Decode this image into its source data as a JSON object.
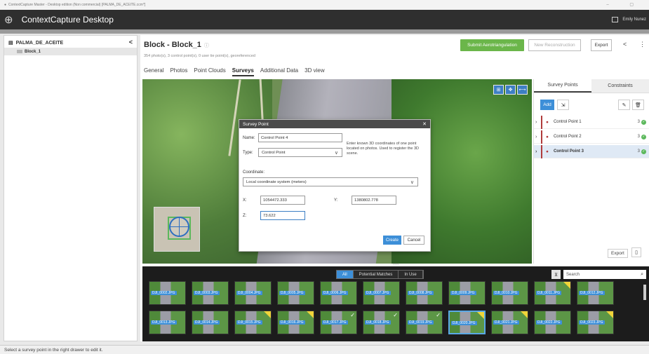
{
  "window": {
    "title": "ContextCapture Master - Desktop edition (Non commercial) [PALMA_DE_ACEITE.ccm*]",
    "controls": "–   ▢"
  },
  "app": {
    "title": "ContextCapture Desktop",
    "user": "Emily Nunez"
  },
  "project": {
    "name": "PALMA_DE_ACEITE",
    "collapse": "<",
    "block": "Block_1"
  },
  "block": {
    "title": "Block - Block_1",
    "info_icon": "ⓘ",
    "subtitle": "354 photo(s), 3 control point(s), 0 user tie point(s), georeferenced",
    "submit_label": "Submit Aerotriangulation",
    "new_recon_label": "New Reconstruction",
    "export_label": "Export"
  },
  "tabs": [
    "General",
    "Photos",
    "Point Clouds",
    "Surveys",
    "Additional Data",
    "3D view"
  ],
  "dialog": {
    "title": "Survey Point",
    "close": "✕",
    "name_label": "Name:",
    "name_value": "Control Point 4",
    "type_label": "Type:",
    "type_value": "Control Point",
    "help_text": "Enter known 3D coordinates of one point located on photos. Used to register the 3D scene.",
    "coord_label": "Coordinate:",
    "coord_system": "Local coordinate system (meters)",
    "x_label": "X:",
    "x_value": "1054472.333",
    "y_label": "Y:",
    "y_value": "1380802.778",
    "z_label": "Z:",
    "z_value": "73.622",
    "create_label": "Create",
    "cancel_label": "Cancel"
  },
  "right_panel": {
    "tab_survey": "Survey Points",
    "tab_constraints": "Constraints",
    "add_label": "Add",
    "export_label": "Export",
    "points": [
      {
        "name": "Control Point 1",
        "count": "3"
      },
      {
        "name": "Control Point 2",
        "count": "3"
      },
      {
        "name": "Control Point 3",
        "count": "3"
      }
    ]
  },
  "filmstrip": {
    "tabs": [
      "All",
      "Potential Matches",
      "In Use"
    ],
    "search_placeholder": "Search",
    "handle": "••••",
    "photos": [
      {
        "label": "DJI_0002.JPG",
        "mark": ""
      },
      {
        "label": "DJI_0003.JPG",
        "mark": ""
      },
      {
        "label": "DJI_0004.JPG",
        "mark": ""
      },
      {
        "label": "DJI_0005.JPG",
        "mark": ""
      },
      {
        "label": "DJI_0006.JPG",
        "mark": ""
      },
      {
        "label": "DJI_0007.JPG",
        "mark": ""
      },
      {
        "label": "DJI_0008.JPG",
        "mark": ""
      },
      {
        "label": "DJI_0009.JPG",
        "mark": ""
      },
      {
        "label": "DJI_0010.JPG",
        "mark": ""
      },
      {
        "label": "DJI_0011.JPG",
        "mark": "tri"
      },
      {
        "label": "DJI_0012.JPG",
        "mark": ""
      },
      {
        "label": "DJI_0013.JPG",
        "mark": ""
      },
      {
        "label": "DJI_0014.JPG",
        "mark": ""
      },
      {
        "label": "DJI_0015.JPG",
        "mark": "tri"
      },
      {
        "label": "DJI_0016.JPG",
        "mark": "tri"
      },
      {
        "label": "DJI_0017.JPG",
        "mark": "chk"
      },
      {
        "label": "DJI_0018.JPG",
        "mark": "chk"
      },
      {
        "label": "DJI_0019.JPG",
        "mark": "chk"
      },
      {
        "label": "DJI_0020.JPG",
        "mark": "tri"
      },
      {
        "label": "DJI_0021.JPG",
        "mark": "tri"
      },
      {
        "label": "DJI_0022.JPG",
        "mark": ""
      },
      {
        "label": "DJI_0023.JPG",
        "mark": "tri"
      }
    ],
    "selected_index": 18
  },
  "status": {
    "text": "Select a survey point in the right drawer to edit it."
  },
  "colors": {
    "accent": "#3d8fd8",
    "submit": "#6bb64a",
    "appbar": "#2f2f2f",
    "control_point": "#b03b3b",
    "ok": "#5cb85c"
  },
  "icons": {
    "app_logo": "globe-drone-icon",
    "info": "info-icon",
    "share": "share-icon",
    "more": "more-vert-icon",
    "pin": "map-pin-icon",
    "check": "check-circle-icon",
    "edit": "pencil-icon",
    "delete": "trash-icon",
    "search": "magnifier-icon"
  }
}
